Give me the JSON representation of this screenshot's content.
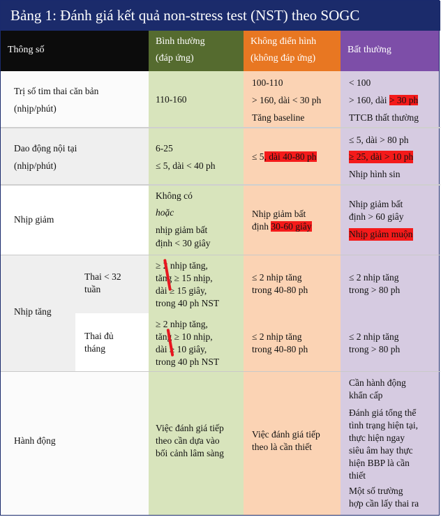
{
  "title": "Bảng 1: Đánh giá kết quả non-stress test (NST) theo SOGC",
  "header": {
    "param": "Thông số",
    "normal_1": "Bình thường",
    "normal_2": "(đáp ứng)",
    "atypical_1": "Không điển hình",
    "atypical_2": "(không đáp ứng)",
    "abnormal": "Bất thường"
  },
  "rows": {
    "baseline": {
      "label_1": "Trị số tim thai căn bản",
      "label_2": "(nhịp/phút)",
      "normal": "110-160",
      "atypical_1": "100-110",
      "atypical_2": "> 160, dài < 30 ph",
      "atypical_3": "Tăng baseline",
      "abnormal_1": "< 100",
      "abnormal_2a": "> 160, dài ",
      "abnormal_2b": "> 30 ph",
      "abnormal_3": "TTCB thất thường"
    },
    "variability": {
      "label_1": "Dao động nội tại",
      "label_2": "(nhịp/phút)",
      "normal_1": "6-25",
      "normal_2": "≤ 5, dài < 40 ph",
      "atypical_a": "≤ 5",
      "atypical_b": ", dài 40-80 ph",
      "abnormal_1": "≤ 5, dài > 80 ph",
      "abnormal_2": "≥ 25, dài > 10 ph",
      "abnormal_3": "Nhịp hình sin"
    },
    "decel": {
      "label": "Nhịp giảm",
      "normal_1": "Không có",
      "normal_2": "hoặc",
      "normal_3": "nhịp giảm bất",
      "normal_4": "định < 30 giây",
      "atypical_1": "Nhịp giảm bất",
      "atypical_2a": "định ",
      "atypical_2b": "30-60 giây",
      "abnormal_1": "Nhịp giảm bất",
      "abnormal_2": "định > 60 giây",
      "abnormal_3": "Nhịp giảm muộn"
    },
    "accel": {
      "label": "Nhịp tăng",
      "sub1_1": "Thai < 32",
      "sub1_2": "tuần",
      "sub1_n1": "≥ 2 nhịp tăng,",
      "sub1_n2": "tăng ≥ 15 nhịp,",
      "sub1_n3": "dài ≥ 15 giây,",
      "sub1_n4": "trong 40 ph NST",
      "sub1_a1": "≤ 2 nhịp tăng",
      "sub1_a2": "trong 40-80 ph",
      "sub1_b1": "≤ 2 nhịp tăng",
      "sub1_b2": "trong > 80 ph",
      "sub2_1": "Thai đủ",
      "sub2_2": "tháng",
      "sub2_n1": "≥ 2 nhịp tăng,",
      "sub2_n2": "tăng ≥ 10 nhịp,",
      "sub2_n3": "dài ≥ 10 giây,",
      "sub2_n4": "trong 40 ph NST",
      "sub2_a1": "≤ 2 nhịp tăng",
      "sub2_a2": "trong 40-80 ph",
      "sub2_b1": "≤ 2 nhịp tăng",
      "sub2_b2": "trong > 80 ph"
    },
    "action": {
      "label": "Hành động",
      "normal_1": "Việc đánh giá tiếp",
      "normal_2": "theo cần dựa vào",
      "normal_3": "bối cảnh lâm sàng",
      "atypical_1": "Việc đánh giá tiếp",
      "atypical_2": "theo là cần thiết",
      "abnormal_1": "Cần hành động",
      "abnormal_2": "khẩn cấp",
      "abnormal_3": "Đánh giá tổng thể",
      "abnormal_4": "tình trạng hiện tại,",
      "abnormal_5": "thực hiện ngay",
      "abnormal_6": "siêu âm hay thực",
      "abnormal_7": "hiện BBP là cần",
      "abnormal_8": "thiết",
      "abnormal_9": "Một số trường",
      "abnormal_10": "hợp cần lấy thai ra"
    }
  },
  "colors": {
    "title_bg": "#1b2b6b",
    "header_param": "#0c0c0c",
    "header_normal": "#556b2f",
    "header_atypical": "#e87722",
    "header_abnormal": "#7d4ea8",
    "normal_fill": "#d8e4bc",
    "atypical_fill": "#fbd3b4",
    "abnormal_fill": "#d6cbe1",
    "highlight": "#f41a1a"
  }
}
